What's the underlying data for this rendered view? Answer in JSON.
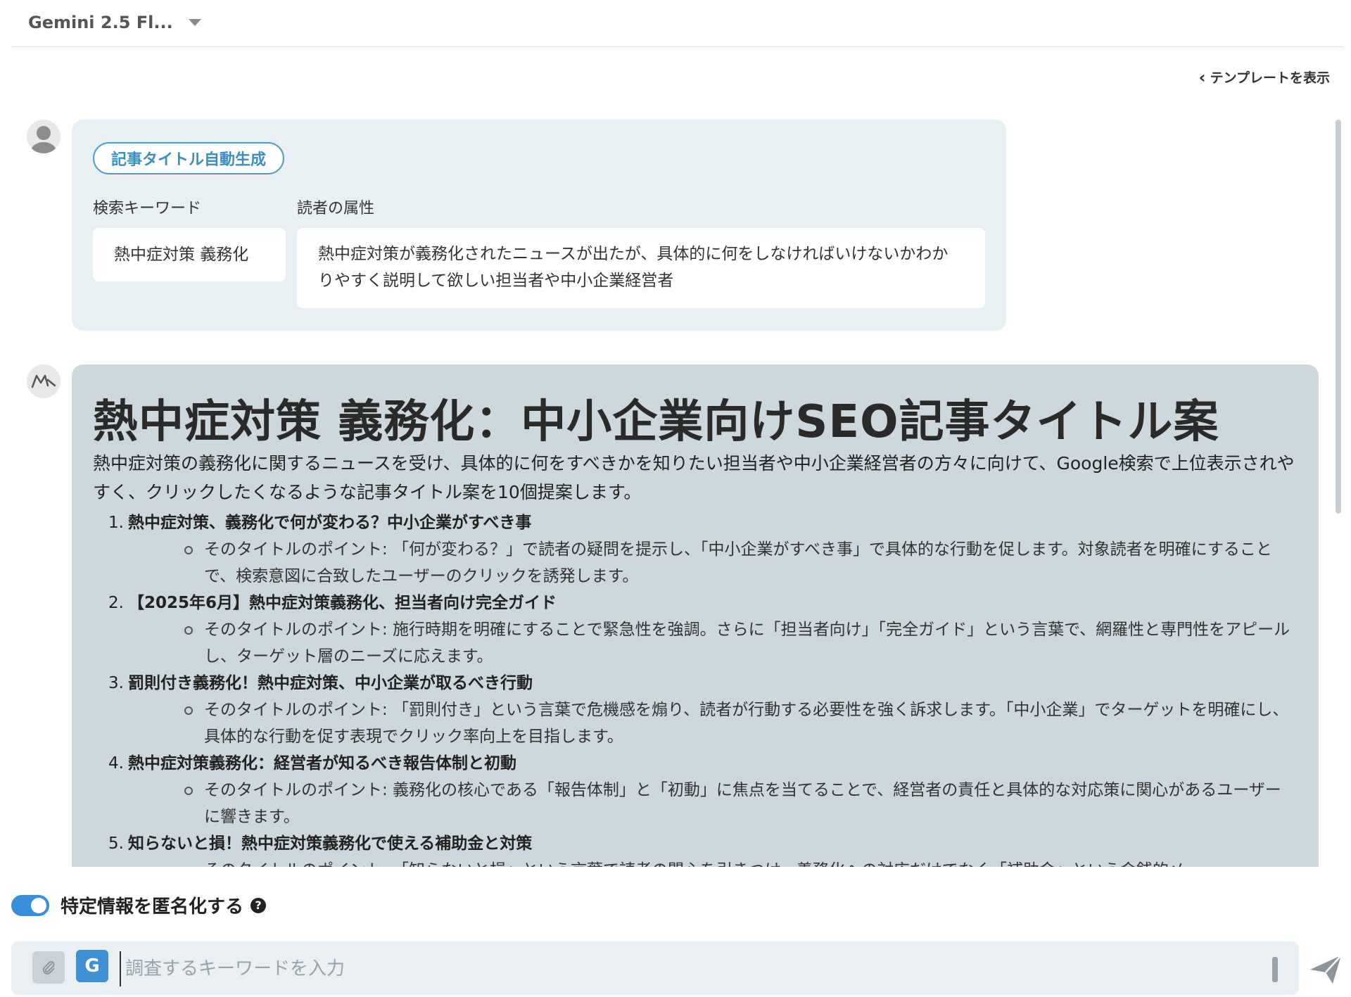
{
  "model_select": {
    "label": "Gemini 2.5 Fl..."
  },
  "template_link": {
    "label": "テンプレートを表示"
  },
  "user_message": {
    "tag": "記事タイトル自動生成",
    "keyword_label": "検索キーワード",
    "keyword_value": "熱中症対策 義務化",
    "audience_label": "読者の属性",
    "audience_value": "熱中症対策が義務化されたニュースが出たが、具体的に何をしなければいけないかわかりやすく説明して欲しい担当者や中小企業経営者"
  },
  "ai_response": {
    "title": "熱中症対策 義務化：中小企業向けSEO記事タイトル案",
    "intro": "熱中症対策の義務化に関するニュースを受け、具体的に何をすべきかを知りたい担当者や中小企業経営者の方々に向けて、Google検索で上位表示されやすく、クリックしたくなるような記事タイトル案を10個提案します。",
    "items": [
      {
        "num": "1.",
        "title": "熱中症対策、義務化で何が変わる？中小企業がすべき事",
        "point": "そのタイトルのポイント: 「何が変わる？」で読者の疑問を提示し、「中小企業がすべき事」で具体的な行動を促します。対象読者を明確にすることで、検索意図に合致したユーザーのクリックを誘発します。"
      },
      {
        "num": "2.",
        "title": "【2025年6月】熱中症対策義務化、担当者向け完全ガイド",
        "point": "そのタイトルのポイント: 施行時期を明確にすることで緊急性を強調。さらに「担当者向け」「完全ガイド」という言葉で、網羅性と専門性をアピールし、ターゲット層のニーズに応えます。"
      },
      {
        "num": "3.",
        "title": "罰則付き義務化！熱中症対策、中小企業が取るべき行動",
        "point": "そのタイトルのポイント: 「罰則付き」という言葉で危機感を煽り、読者が行動する必要性を強く訴求します。「中小企業」でターゲットを明確にし、具体的な行動を促す表現でクリック率向上を目指します。"
      },
      {
        "num": "4.",
        "title": "熱中症対策義務化：経営者が知るべき報告体制と初動",
        "point": "そのタイトルのポイント: 義務化の核心である「報告体制」と「初動」に焦点を当てることで、経営者の責任と具体的な対応策に関心があるユーザーに響きます。"
      },
      {
        "num": "5.",
        "title": "知らないと損！熱中症対策義務化で使える補助金と対策",
        "point": "そのタイトルのポイント: 「知らないと損」という言葉で読者の関心を引きつけ、義務化への対応だけでなく「補助金」という金銭的メ"
      }
    ]
  },
  "anonymize": {
    "label": "特定情報を匿名化する",
    "enabled": true
  },
  "input": {
    "g_label": "G",
    "placeholder": "調査するキーワードを入力",
    "value": ""
  },
  "colors": {
    "accent": "#3a8fdc",
    "user_card_bg": "#e9f0f4",
    "ai_card_bg": "#ccd8dd",
    "tag_border": "#4d9cc9"
  }
}
